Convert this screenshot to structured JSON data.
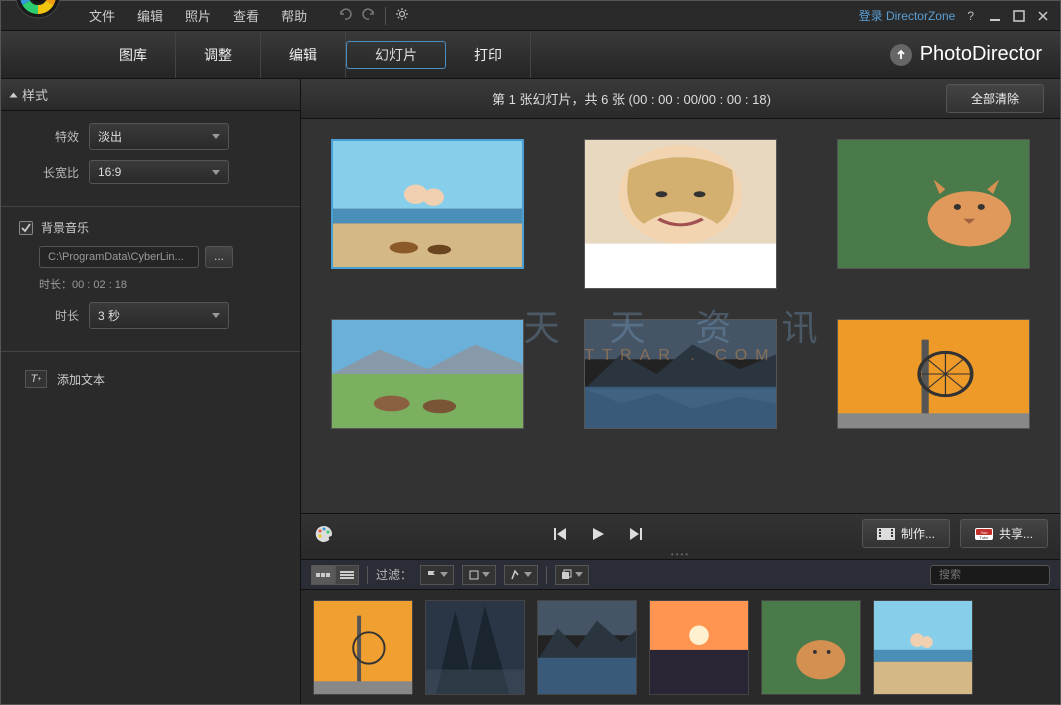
{
  "menu": {
    "file": "文件",
    "edit": "编辑",
    "photo": "照片",
    "view": "查看",
    "help": "帮助"
  },
  "topright": {
    "login": "登录 DirectorZone"
  },
  "tabs": {
    "library": "图库",
    "adjust": "调整",
    "editing": "编辑",
    "slideshow": "幻灯片",
    "print": "打印"
  },
  "brand": "PhotoDirector",
  "sidebar": {
    "style_header": "样式",
    "effect_label": "特效",
    "effect_value": "淡出",
    "ratio_label": "长宽比",
    "ratio_value": "16:9",
    "bgm_label": "背景音乐",
    "bgm_path": "C:\\ProgramData\\CyberLin...",
    "bgm_browse": "...",
    "bgm_duration": "时长：00 : 02 : 18",
    "duration_label": "时长",
    "duration_value": "3 秒",
    "add_text": "添加文本"
  },
  "slides": {
    "counter": "第   1 张幻灯片，共   6 张  (00 : 00 : 00/00 : 00 : 18)",
    "clear_all": "全部清除"
  },
  "watermark": {
    "main": "天 天 资 讯",
    "sub": "TTRAR . COM"
  },
  "playbar": {
    "create": "制作...",
    "share": "共享..."
  },
  "filter": {
    "label": "过滤：",
    "search_placeholder": "搜索"
  }
}
